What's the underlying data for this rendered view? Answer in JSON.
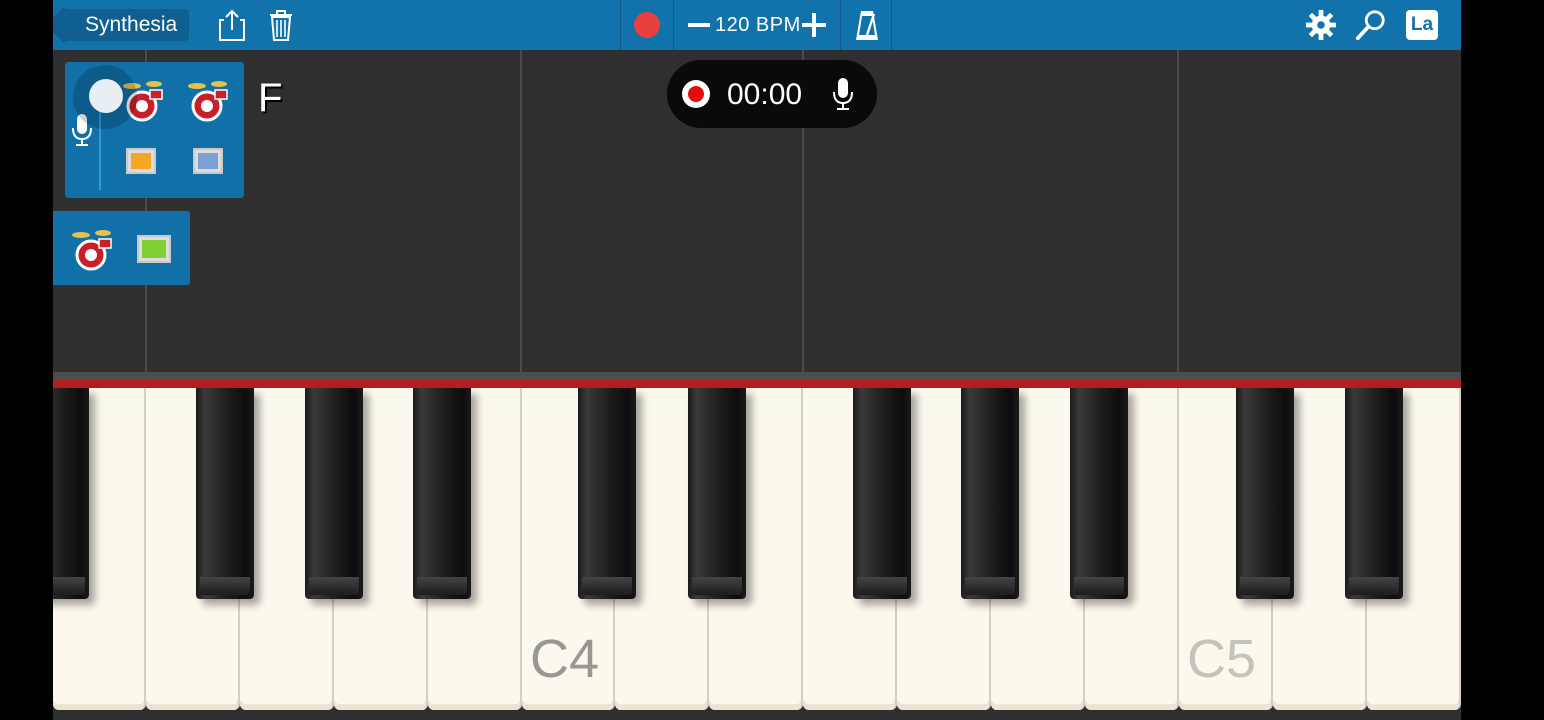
{
  "toolbar": {
    "back_label": "Synthesia",
    "tempo_label": "120 BPM",
    "language_badge": "La",
    "icons": [
      "share-icon",
      "trash-icon",
      "record-icon",
      "minus-icon",
      "plus-icon",
      "metronome-icon",
      "gear-icon",
      "search-icon",
      "language-icon"
    ]
  },
  "recorder": {
    "time": "00:00"
  },
  "tracks": {
    "current_key": "F",
    "colors": {
      "pad_orange": "#f5a623",
      "pad_blue": "#7aa0d6",
      "pad_green": "#7fd136"
    }
  },
  "keyboard": {
    "octave_labels": [
      "C4",
      "C5"
    ],
    "accent_color": "#b41d22"
  },
  "colors": {
    "toolbar": "#1272ac",
    "record": "#e8403d",
    "background": "#2f2f2f"
  }
}
